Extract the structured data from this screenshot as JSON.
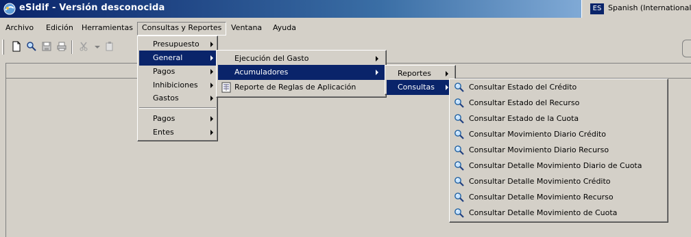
{
  "window": {
    "title": "eSidif - Versión desconocida",
    "language_code": "ES",
    "language_name": "Spanish (International Sort)"
  },
  "menubar": [
    "Archivo",
    "Edición",
    "Herramientas",
    "Consultas y Reportes",
    "Ventana",
    "Ayuda"
  ],
  "consultas_menu": {
    "items": [
      "Presupuesto",
      "General",
      "Pagos",
      "Inhibiciones",
      "Gastos",
      "Pagos",
      "Entes"
    ]
  },
  "general_menu": {
    "items": [
      "Ejecución del Gasto",
      "Acumuladores",
      "Reporte de Reglas de Aplicación"
    ]
  },
  "acumuladores_menu": {
    "items": [
      "Reportes",
      "Consultas"
    ]
  },
  "consultas_submenu": {
    "items": [
      "Consultar Estado del Crédito",
      "Consultar Estado del Recurso",
      "Consultar Estado de la Cuota",
      "Consultar Movimiento Diario Crédito",
      "Consultar Movimiento Diario Recurso",
      "Consultar Detalle Movimiento Diario de Cuota",
      "Consultar Detalle Movimiento Crédito",
      "Consultar Detalle Movimiento Recurso",
      "Consultar Detalle Movimiento de Cuota"
    ]
  },
  "icons": {
    "app": "esidif-app-icon",
    "new": "new-document-icon",
    "search": "search-icon",
    "save": "save-icon",
    "print": "print-icon",
    "query": "magnifier-query-icon",
    "report": "report-document-icon"
  },
  "colors": {
    "selection": "#0a246a",
    "window_bg": "#d4d0c8"
  }
}
